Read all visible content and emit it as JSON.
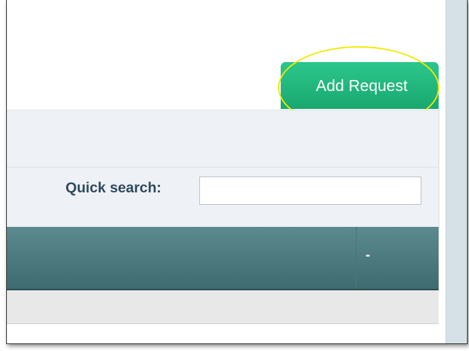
{
  "toolbar": {
    "add_request_label": "Add Request"
  },
  "search": {
    "label": "Quick search:",
    "value": "",
    "placeholder": ""
  },
  "table": {
    "columns": [
      "-"
    ]
  },
  "colors": {
    "button_green": "#1fb57c",
    "header_teal": "#4d7b80",
    "panel_bg": "#eef1f5",
    "label_text": "#2f4a5e",
    "highlight": "#f2ea00"
  }
}
